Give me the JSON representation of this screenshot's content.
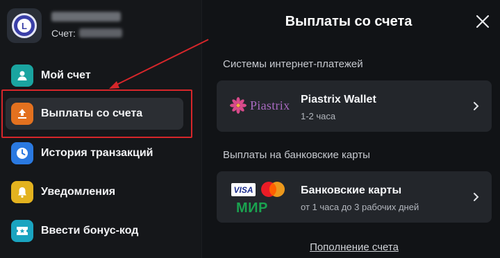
{
  "sidebar": {
    "user_name": "Имямма Г.",
    "account_label": "Счет:",
    "account_number": "12345678",
    "items": [
      {
        "label": "Мой счет",
        "icon": "user-icon",
        "color": "#1aa4a0"
      },
      {
        "label": "Выплаты со счета",
        "icon": "upload-icon",
        "color": "#e3711f"
      },
      {
        "label": "История транзакций",
        "icon": "clock-icon",
        "color": "#2a79e0"
      },
      {
        "label": "Уведомления",
        "icon": "bell-icon",
        "color": "#e3b21f"
      },
      {
        "label": "Ввести бонус-код",
        "icon": "ticket-icon",
        "color": "#1aa4c0"
      }
    ],
    "active_index": 1
  },
  "panel": {
    "title": "Выплаты со счета",
    "section_online": "Системы интернет-платежей",
    "section_cards": "Выплаты на банковские карты",
    "piastrix": {
      "logo_text": "Piastrix",
      "name": "Piastrix Wallet",
      "time": "1-2 часа"
    },
    "bank_cards": {
      "visa": "VISA",
      "mir": "МИР",
      "name": "Банковские карты",
      "time": "от 1 часа до 3 рабочих дней"
    },
    "footer_link": "Пополнение счета"
  },
  "colors": {
    "highlight": "#d6262a",
    "background": "#111316",
    "card": "#23262b"
  }
}
